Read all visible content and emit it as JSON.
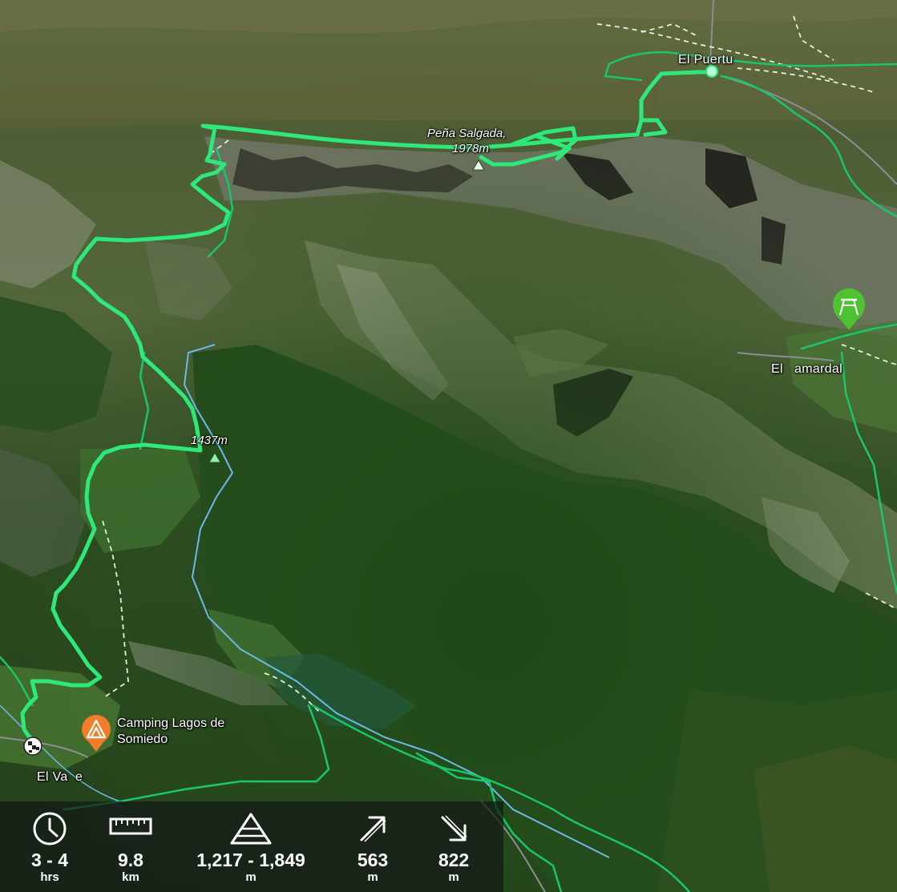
{
  "map": {
    "labels": {
      "el_puertu": "El Puertu",
      "pena_salgada_name": "Peña Salgada,",
      "pena_salgada_elev": "1978m",
      "peak_1437": "1437m",
      "el_llamardal": "El   amardal",
      "camping_line1": "Camping Lagos de",
      "camping_line2": "Somiedo",
      "el_valle": "El Va  e"
    },
    "icons": [
      "peak-marker",
      "campground-marker",
      "picnic-marker",
      "trail-start-flag"
    ],
    "colors": {
      "route": "#2ee87a",
      "trail": "#19c66c",
      "river": "#6cb8e8",
      "camping": "#f07d2a",
      "picnic": "#4ec331"
    }
  },
  "stats": [
    {
      "icon": "clock-icon",
      "value": "3 - 4",
      "unit": "hrs"
    },
    {
      "icon": "ruler-icon",
      "value": "9.8",
      "unit": "km"
    },
    {
      "icon": "elevation-range-icon",
      "value": "1,217 - 1,849",
      "unit": "m"
    },
    {
      "icon": "ascent-arrow-icon",
      "value": "563",
      "unit": "m"
    },
    {
      "icon": "descent-arrow-icon",
      "value": "822",
      "unit": "m"
    }
  ]
}
